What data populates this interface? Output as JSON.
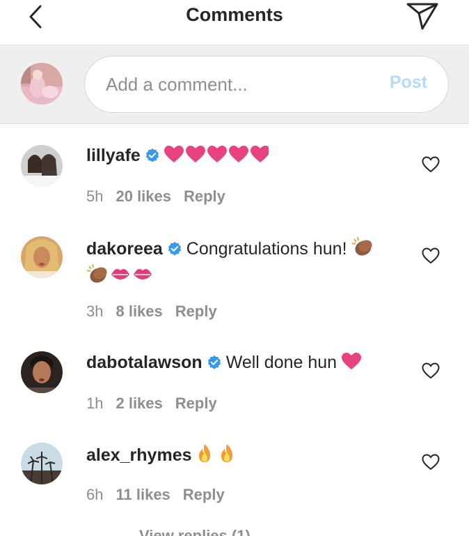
{
  "header": {
    "title": "Comments"
  },
  "composer": {
    "placeholder": "Add a comment...",
    "post_label": "Post"
  },
  "comments": [
    {
      "username": "lillyafe",
      "text": "",
      "time": "5h",
      "likes": "20 likes",
      "reply": "Reply"
    },
    {
      "username": "dakoreea",
      "text": "Congratulations hun!",
      "time": "3h",
      "likes": "8 likes",
      "reply": "Reply"
    },
    {
      "username": "dabotalawson",
      "text": "Well done hun",
      "time": "1h",
      "likes": "2 likes",
      "reply": "Reply"
    },
    {
      "username": "alex_rhymes",
      "text": "",
      "time": "6h",
      "likes": "11 likes",
      "reply": "Reply"
    }
  ],
  "view_replies_label": "View replies (1)",
  "colors": {
    "verified": "#3897f0",
    "post_disabled": "#b3dbfa",
    "heart_emoji": "#e8437f",
    "meta_grey": "#8e8e8e"
  }
}
